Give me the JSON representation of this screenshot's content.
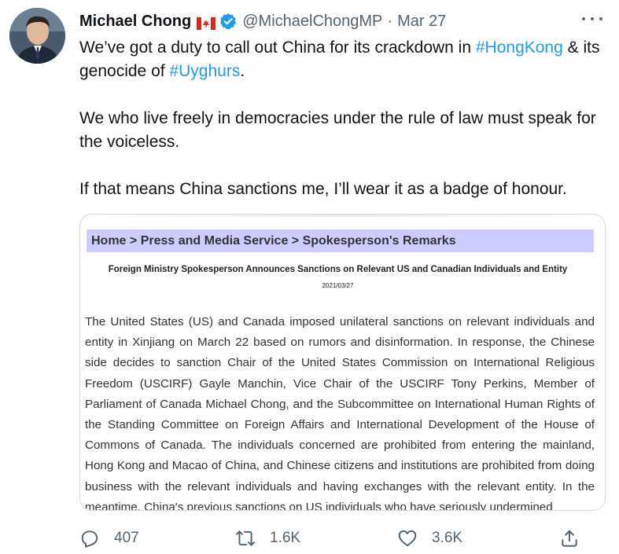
{
  "tweet": {
    "author": {
      "display_name": "Michael Chong",
      "handle": "@MichaelChongMP",
      "flag_icon": "canada-flag-icon",
      "verified_icon": "verified-badge-icon"
    },
    "separator": "·",
    "date": "Mar 27",
    "text": {
      "line1_before": "We’ve got a duty to call out China for its crackdown in ",
      "hashtag1": "#HongKong",
      "line1_middle": " & its genocide of ",
      "hashtag2": "#Uyghurs",
      "line1_after": ".",
      "paragraph2": "We who live freely in democracies under the rule of law must speak for the voiceless.",
      "paragraph3": "If that means China sanctions me, I’ll wear it as a badge of honour."
    },
    "media": {
      "breadcrumb": "Home > Press and Media Service > Spokesperson's Remarks",
      "title": "Foreign Ministry Spokesperson Announces Sanctions on Relevant US and Canadian Individuals and Entity",
      "date": "2021/03/27",
      "body": "The United States (US) and Canada imposed unilateral sanctions on relevant individuals and entity in Xinjiang on March 22 based on rumors and disinformation. In response, the Chinese side decides to sanction Chair of the United States Commission on International Religious Freedom (USCIRF) Gayle Manchin, Vice Chair of the USCIRF Tony Perkins, Member of Parliament of Canada Michael Chong, and the Subcommittee on International Human Rights of the Standing Committee on Foreign Affairs and International Development of the House of Commons of Canada. The individuals concerned are prohibited from entering the mainland, Hong Kong and Macao of China, and Chinese citizens and institutions are prohibited from doing business with the relevant individuals and having exchanges with the relevant entity. In the meantime, China's previous sanctions on US individuals who have seriously undermined"
    },
    "actions": {
      "replies": "407",
      "retweets": "1.6K",
      "likes": "3.6K"
    }
  },
  "colors": {
    "link": "#1d9bf0",
    "secondary_text": "#536471",
    "breadcrumb_bg": "#ccccff"
  }
}
